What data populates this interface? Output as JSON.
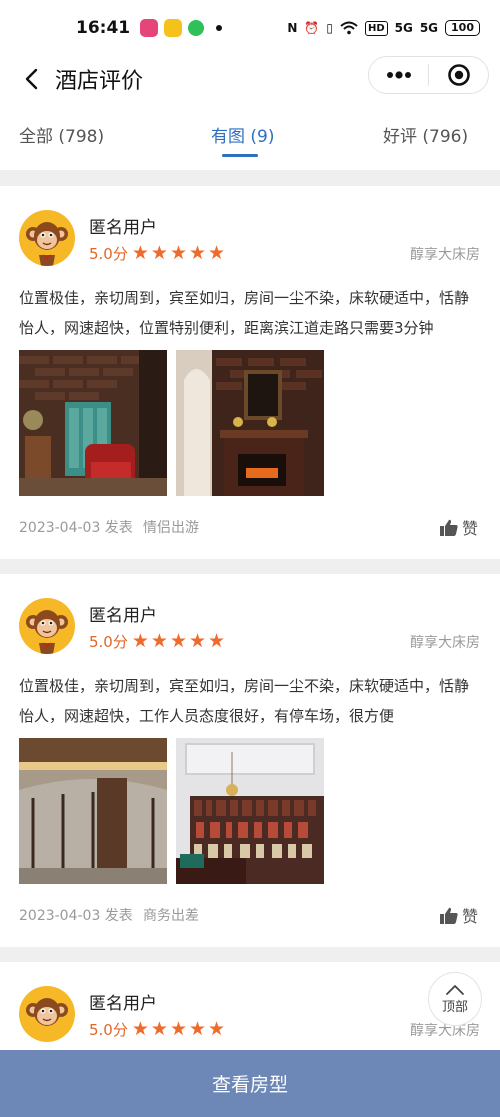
{
  "status_bar": {
    "time": "16:41",
    "net1": "5G",
    "net2": "5G",
    "hd": "HD",
    "battery": "100"
  },
  "nav": {
    "title": "酒店评价"
  },
  "tabs": [
    {
      "label": "全部 (798)"
    },
    {
      "label": "有图 (9)",
      "active": true
    },
    {
      "label": "好评 (796)"
    }
  ],
  "reviews": [
    {
      "user": "匿名用户",
      "score": "5.0分",
      "rating": 5,
      "room": "醇享大床房",
      "text": "位置极佳，亲切周到，宾至如归，房间一尘不染，床软硬适中，恬静怡人，网速超快，位置特别便利，距离滨江道走路只需要3分钟",
      "date": "2023-04-03 发表",
      "trip": "情侣出游",
      "like": "赞"
    },
    {
      "user": "匿名用户",
      "score": "5.0分",
      "rating": 5,
      "room": "醇享大床房",
      "text": "位置极佳，亲切周到，宾至如归，房间一尘不染，床软硬适中，恬静怡人，网速超快，工作人员态度很好，有停车场，很方便",
      "date": "2023-04-03 发表",
      "trip": "商务出差",
      "like": "赞"
    },
    {
      "user": "匿名用户",
      "score": "5.0分",
      "rating": 5,
      "room": "醇享大床房"
    }
  ],
  "to_top": "顶部",
  "bottom_button": "查看房型",
  "colors": {
    "accent": "#2d6fc2",
    "star": "#ef6b2c",
    "bottom": "#6d88b6"
  }
}
